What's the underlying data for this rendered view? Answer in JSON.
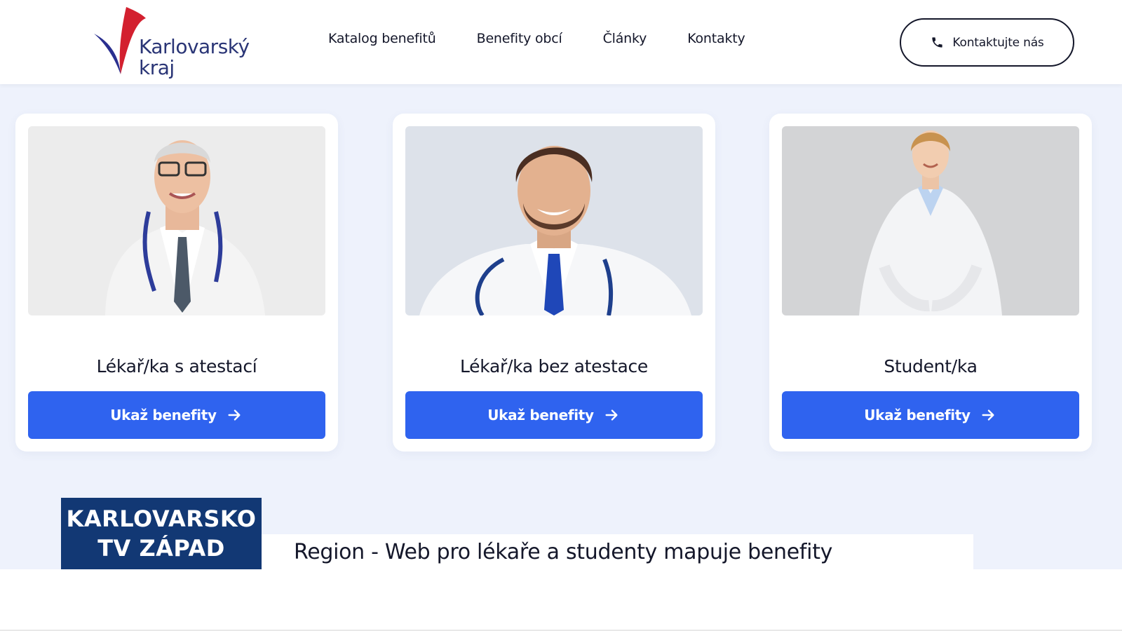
{
  "header": {
    "logo": {
      "line1": "Karlovarský",
      "line2": "kraj"
    },
    "nav": [
      {
        "label": "Katalog benefitů"
      },
      {
        "label": "Benefity obcí"
      },
      {
        "label": "Články"
      },
      {
        "label": "Kontakty"
      }
    ],
    "contact_button": {
      "label": "Kontaktujte nás",
      "icon": "phone-icon"
    }
  },
  "cards": [
    {
      "title": "Lékař/ka s atestací",
      "button": "Ukaž benefity",
      "image": "senior-doctor-photo"
    },
    {
      "title": "Lékař/ka bez atestace",
      "button": "Ukaž benefity",
      "image": "young-doctor-photo"
    },
    {
      "title": "Student/ka",
      "button": "Ukaž benefity",
      "image": "student-photo"
    }
  ],
  "tv_overlay": {
    "logo_line1": "KARLOVARSKO",
    "logo_line2": "TV ZÁPAD",
    "caption": "Region - Web pro lékaře a studenty mapuje benefity"
  },
  "colors": {
    "brand_blue": "#2f63ef",
    "brand_navy": "#2a3576",
    "brand_red": "#d3202f",
    "page_bg": "#eef2fc",
    "tv_blue": "#123874"
  }
}
